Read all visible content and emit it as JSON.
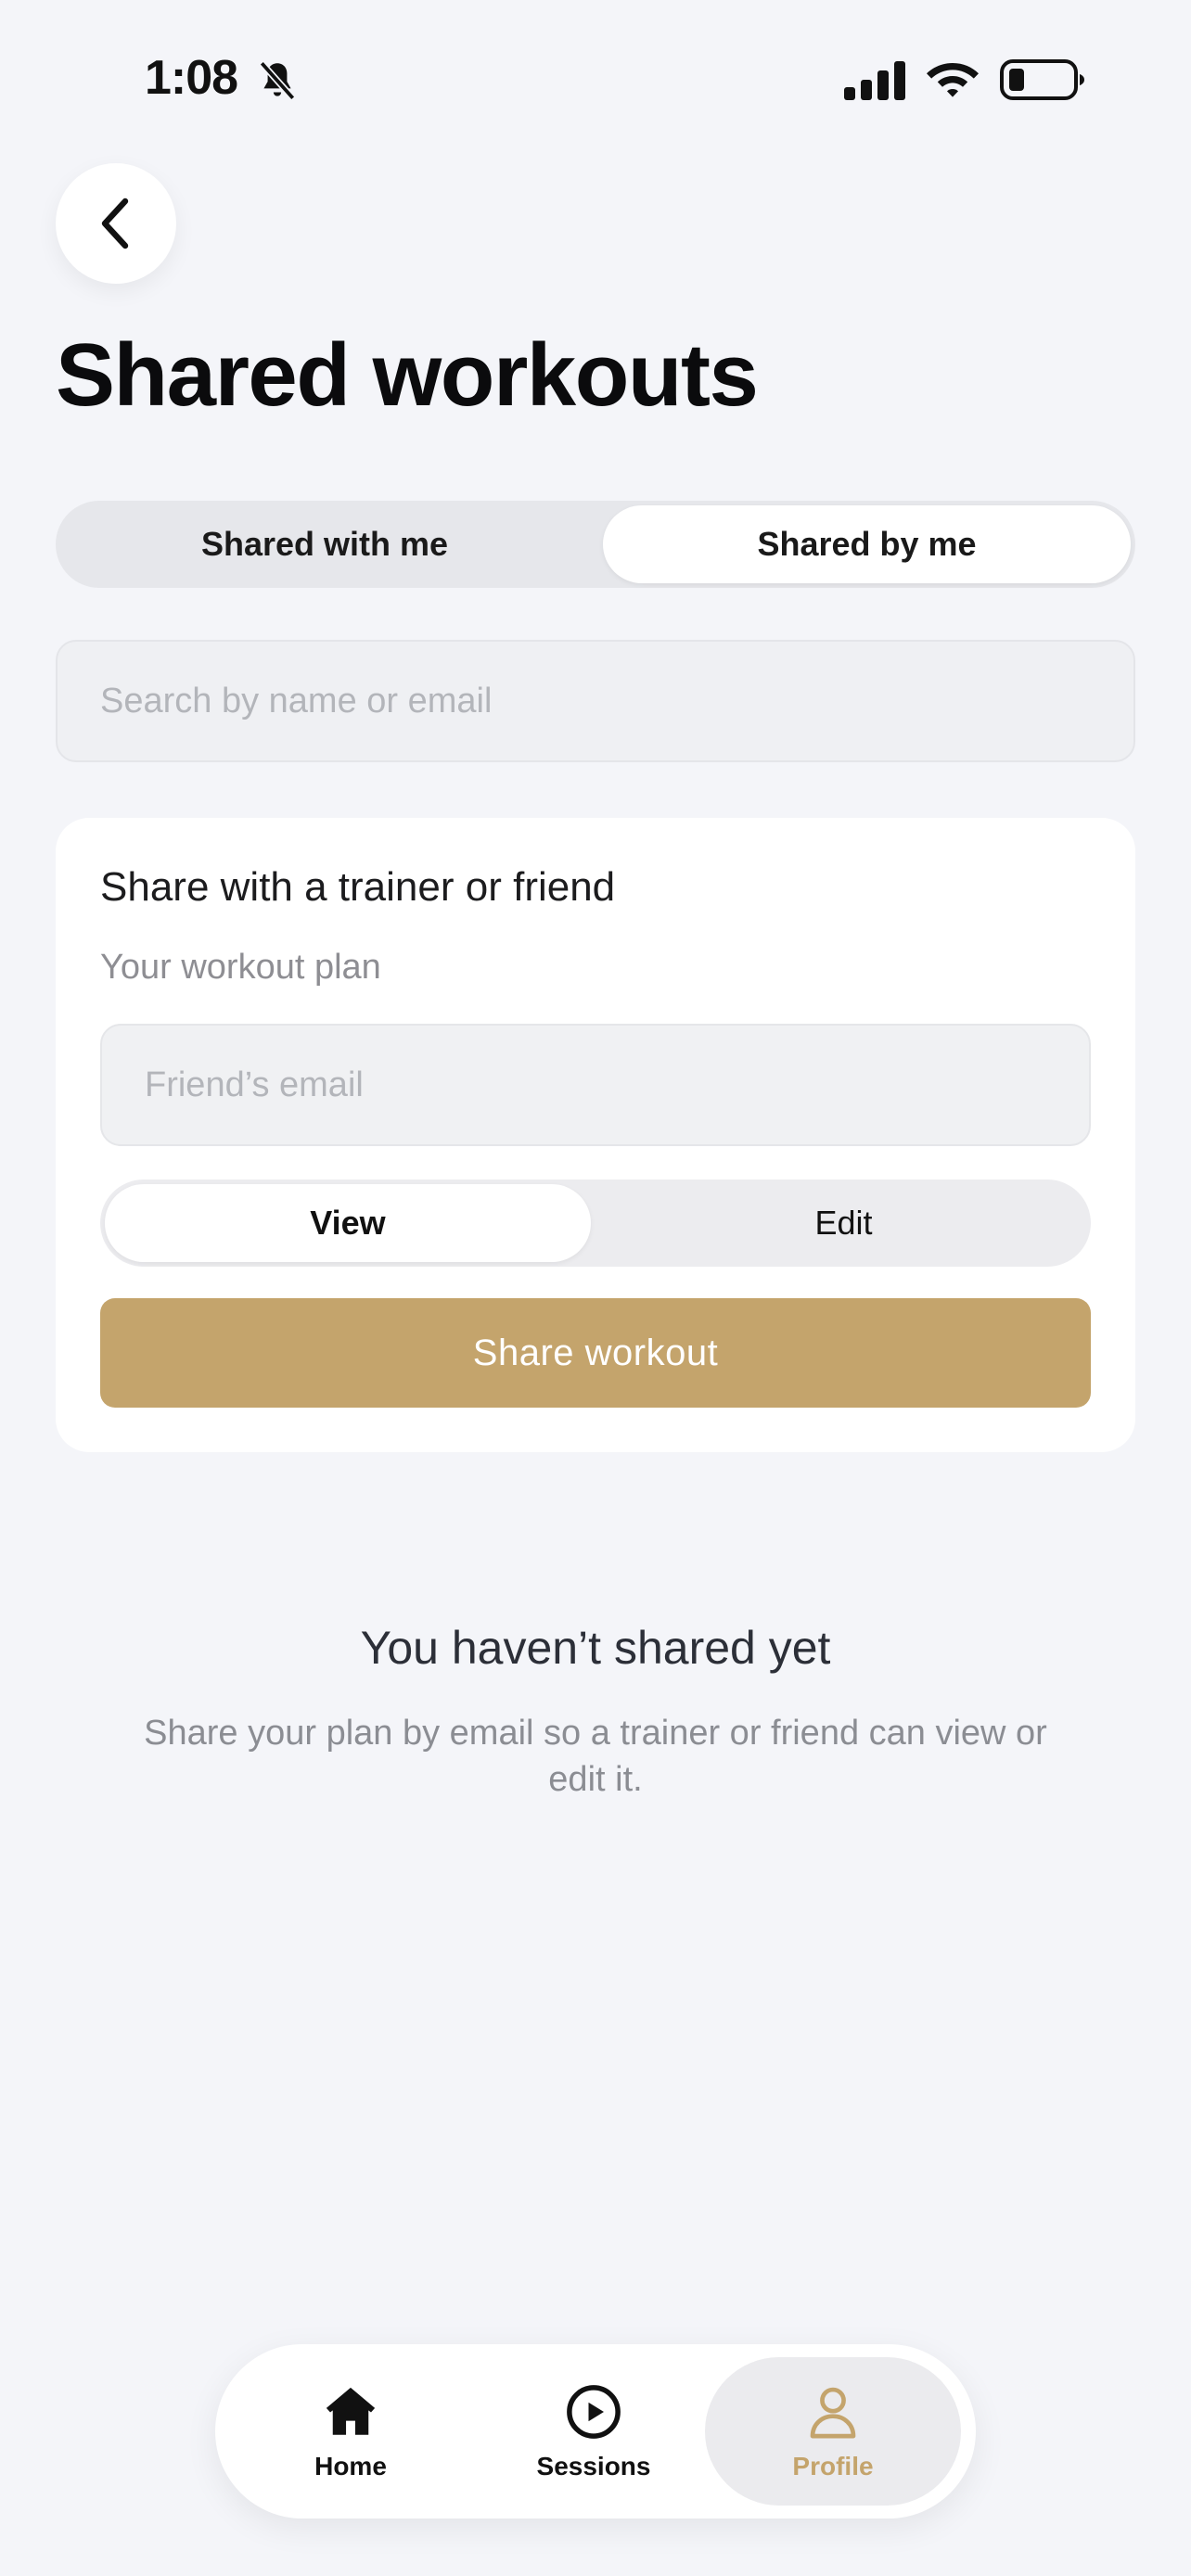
{
  "status_bar": {
    "time": "1:08",
    "icons": [
      "bell-slash-icon",
      "signal-icon",
      "wifi-icon",
      "battery-icon"
    ]
  },
  "header": {
    "back_icon": "chevron-left-icon",
    "title": "Shared workouts"
  },
  "tabs": {
    "options": [
      "Shared with me",
      "Shared by me"
    ],
    "selected": "Shared by me"
  },
  "search": {
    "placeholder": "Search by name or email",
    "value": ""
  },
  "share_card": {
    "title": "Share with a trainer or friend",
    "subtitle": "Your workout plan",
    "email_placeholder": "Friend’s email",
    "permission": {
      "options": [
        "View",
        "Edit"
      ],
      "selected": "View"
    },
    "button_label": "Share workout"
  },
  "empty_state": {
    "title": "You haven’t shared yet",
    "text": "Share your plan by email so a trainer or friend can view or edit it."
  },
  "bottom_nav": {
    "items": [
      {
        "label": "Home",
        "icon": "home-icon"
      },
      {
        "label": "Sessions",
        "icon": "play-circle-icon"
      },
      {
        "label": "Profile",
        "icon": "person-icon"
      }
    ],
    "active": "Profile"
  },
  "colors": {
    "accent": "#c4a46c",
    "background": "#f4f5f9",
    "card": "#ffffff"
  }
}
